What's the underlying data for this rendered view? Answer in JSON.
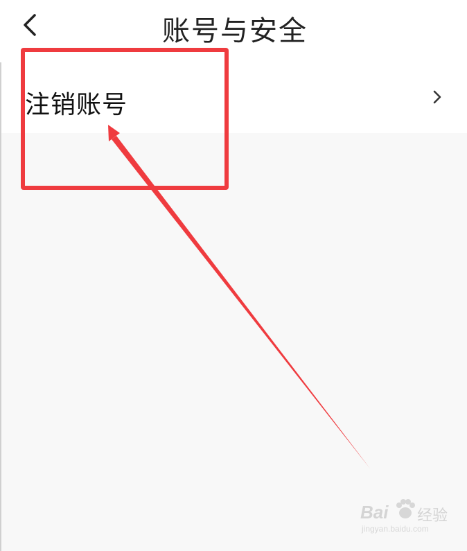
{
  "header": {
    "title": "账号与安全",
    "back_icon": "chevron-left-icon"
  },
  "settings": {
    "items": [
      {
        "label": "注销账号",
        "icon": "chevron-right-icon"
      }
    ]
  },
  "annotation": {
    "box_color": "#ef3b3f",
    "arrow_color": "#ef3b3f"
  },
  "watermark": {
    "brand": "Bai",
    "brand_suffix_icon": "paw-icon",
    "jingyan": "经验",
    "url": "jingyan.baidu.com"
  }
}
